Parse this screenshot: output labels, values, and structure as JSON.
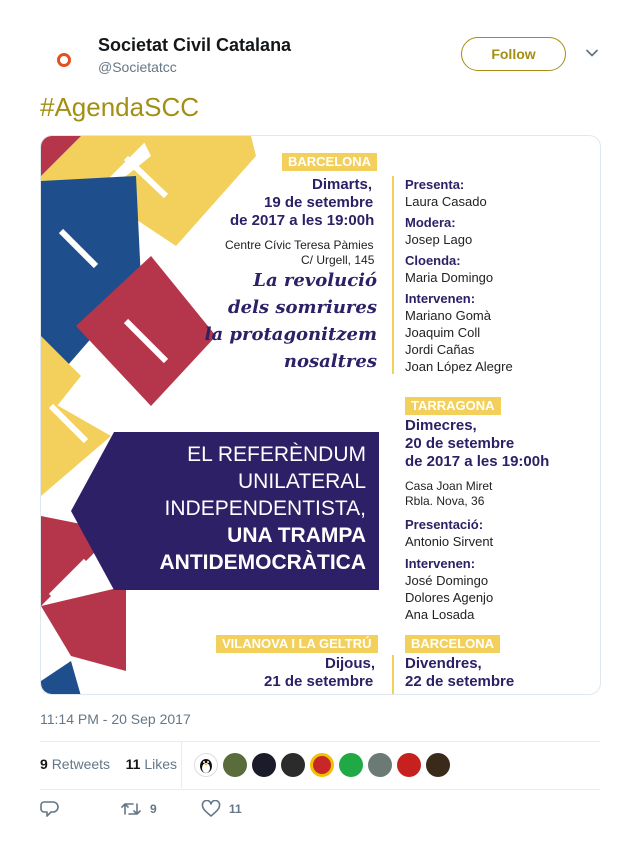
{
  "account": {
    "name": "Societat Civil Catalana",
    "handle": "@Societatcc",
    "follow_label": "Follow"
  },
  "tweet": {
    "text": "#AgendaSCC",
    "timestamp": "11:14 PM - 20 Sep 2017"
  },
  "poster": {
    "event1": {
      "city": "BARCELONA",
      "day": "Dimarts,",
      "date": "19 de setembre",
      "time": "de 2017 a les 19:00h",
      "venue": "Centre Cívic Teresa Pàmies",
      "address": "C/ Urgell, 145",
      "slogan": [
        "La revolució",
        "dels somriures",
        "la protagonitzem",
        "nosaltres"
      ],
      "presenta_label": "Presenta:",
      "presenta": "Laura Casado",
      "modera_label": "Modera:",
      "modera": "Josep Lago",
      "cloenda_label": "Cloenda:",
      "cloenda": "Maria Domingo",
      "intervenen_label": "Intervenen:",
      "intervenen": [
        "Mariano Gomà",
        "Joaquim Coll",
        "Jordi Cañas",
        "Joan López Alegre"
      ]
    },
    "event2": {
      "city": "TARRAGONA",
      "day": "Dimecres,",
      "date": "20 de setembre",
      "time": "de 2017 a les 19:00h",
      "venue": "Casa Joan Miret",
      "address": "Rbla. Nova, 36",
      "presentacio_label": "Presentació:",
      "presentacio": "Antonio Sirvent",
      "intervenen_label": "Intervenen:",
      "intervenen": [
        "José Domingo",
        "Dolores Agenjo",
        "Ana Losada"
      ]
    },
    "event3": {
      "city": "VILANOVA I LA GELTRÚ",
      "day": "Dijous,",
      "date": "21 de setembre"
    },
    "event4": {
      "city": "BARCELONA",
      "day": "Divendres,",
      "date": "22 de setembre"
    },
    "banner": {
      "line1": "EL REFERÈNDUM",
      "line2": "UNILATERAL",
      "line3": "INDEPENDENTISTA,",
      "line4": "UNA TRAMPA",
      "line5": "ANTIDEMOCRÀTICA"
    },
    "colors": {
      "yellow": "#f2d05b",
      "blue": "#1f4e8c",
      "red": "#b5364a",
      "purple": "#2d2066"
    }
  },
  "stats": {
    "retweets_count": "9",
    "retweets_label": "Retweets",
    "likes_count": "11",
    "likes_label": "Likes"
  },
  "likers": [
    "penguin-avatar",
    "avatar-2",
    "avatar-3",
    "avatar-4",
    "avatar-5",
    "avatar-6",
    "avatar-7",
    "avatar-8",
    "avatar-9"
  ],
  "actions": {
    "reply_icon": "reply-icon",
    "retweet_icon": "retweet-icon",
    "retweet_count": "9",
    "like_icon": "heart-icon",
    "like_count": "11"
  },
  "theme": {
    "accent": "#a38f13",
    "muted": "#657786"
  }
}
